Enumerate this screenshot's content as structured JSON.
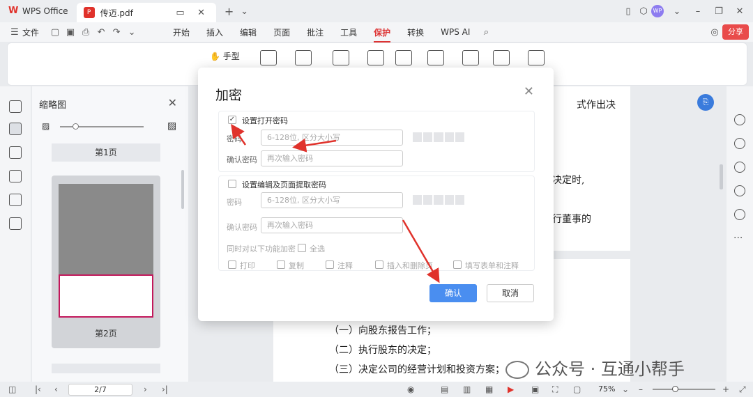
{
  "titlebar": {
    "app_name": "WPS Office",
    "doc_tab": "传迈.pdf",
    "avatar_text": "WP"
  },
  "menubar": {
    "file": "文件",
    "items": [
      "开始",
      "插入",
      "编辑",
      "页面",
      "批注",
      "工具",
      "保护",
      "转换",
      "WPS AI"
    ],
    "active_index": 6,
    "share": "分享"
  },
  "ribbon": {
    "hand_tool": "手型"
  },
  "thumbnail_panel": {
    "title": "缩略图",
    "page1_label": "第1页",
    "page2_label": "第2页"
  },
  "document": {
    "line1": "式作出决",
    "line2": "决定时,",
    "line3": "行董事的",
    "item1": "（一）向股东报告工作；",
    "item2": "（二）执行股东的决定；",
    "item3": "（三）决定公司的经营计划和投资方案；"
  },
  "statusbar": {
    "page": "2/7",
    "zoom": "75%",
    "zoom_level": 0.35
  },
  "dialog": {
    "title": "加密",
    "open_password": {
      "checkbox_label": "设置打开密码",
      "checked": true,
      "password_label": "密码",
      "password_placeholder": "6-128位, 区分大小写",
      "confirm_label": "确认密码",
      "confirm_placeholder": "再次输入密码"
    },
    "edit_password": {
      "checkbox_label": "设置编辑及页面提取密码",
      "checked": false,
      "password_label": "密码",
      "password_placeholder": "6-128位, 区分大小写",
      "confirm_label": "确认密码",
      "confirm_placeholder": "再次输入密码",
      "lock_label": "同时对以下功能加密",
      "select_all": "全选",
      "options": [
        "打印",
        "复制",
        "注释",
        "插入和删除页",
        "填写表单和注释"
      ]
    },
    "ok": "确认",
    "cancel": "取消"
  },
  "watermark": {
    "text": "公众号 · 互通小帮手"
  },
  "colors": {
    "accent_red": "#d33333",
    "primary_blue": "#4a8ef0",
    "annotation_red": "#e0322b"
  }
}
